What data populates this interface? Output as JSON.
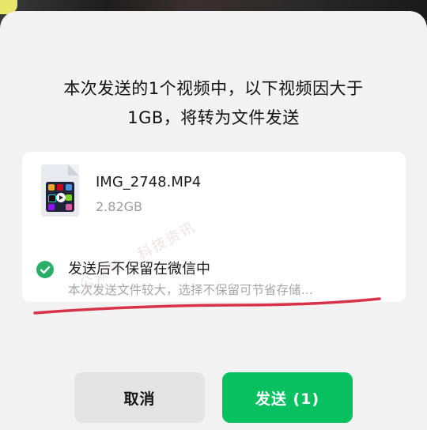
{
  "dialog": {
    "title_line1": "本次发送的1个视频中，以下视频因大于",
    "title_line2": "1GB，将转为文件发送"
  },
  "file": {
    "name": "IMG_2748.MP4",
    "size": "2.82GB",
    "icon": "video-file-icon"
  },
  "option": {
    "checked": true,
    "label": "发送后不保留在微信中",
    "description": "本次发送文件较大，选择不保留可节省存储…"
  },
  "watermark": {
    "text": "公众号 · 科技资讯"
  },
  "buttons": {
    "cancel_label": "取消",
    "send_label": "发送 (1)"
  },
  "colors": {
    "accent_green": "#07c160",
    "check_green": "#2aae67",
    "underline_red": "#d8314a"
  }
}
